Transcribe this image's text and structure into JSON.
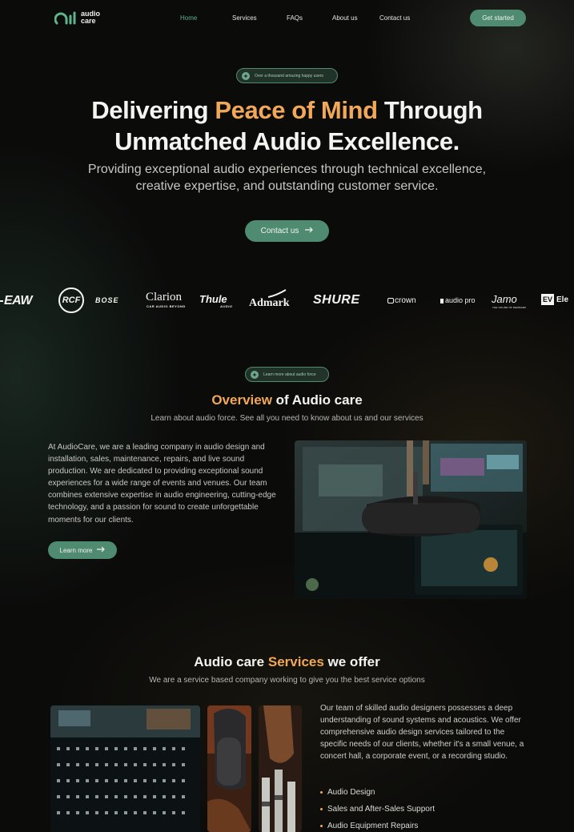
{
  "nav": {
    "logo_line1": "audio",
    "logo_line2": "care",
    "links": [
      "Home",
      "Services",
      "FAQs",
      "About us",
      "Contact us"
    ],
    "cta": "Get started"
  },
  "hero": {
    "pill": "Over a thousand amazing happy users",
    "title_pre": "Delivering ",
    "title_accent": "Peace of Mind",
    "title_post": " Through",
    "title_line2": "Unmatched Audio Excellence.",
    "subtitle_line1": "Providing exceptional audio experiences through technical excellence,",
    "subtitle_line2": "creative expertise, and outstanding customer service.",
    "cta": "Contact us"
  },
  "brands": {
    "eaw": "EAW",
    "rcf": "RCF",
    "bose": "BOSE",
    "clarion": "Clarion",
    "clarion_tag": "CAR AUDIO BEYOND",
    "thule": "Thule",
    "thule_tag": "AUDIO",
    "admark": "Admark",
    "shure": "SHURE",
    "crown": "crown",
    "audiopro": "audio pro",
    "jamo": "Jamo",
    "jamo_tag": "THE SOUND OF DENMARK",
    "ev": "EV",
    "ev_text": "Ele"
  },
  "overview": {
    "pill": "Learn more about audio force",
    "title_accent": "Overview",
    "title_post": " of Audio care",
    "subtitle": "Learn about audio force. See all you need to know about us and our services",
    "body": "At AudioCare, we are a leading company in audio design and installation, sales, maintenance, repairs, and live sound production. We are dedicated to providing exceptional sound experiences for a wide range of events and venues. Our team combines extensive expertise in audio engineering, cutting-edge technology, and a passion for sound to create unforgettable moments for our clients.",
    "cta": "Learn more"
  },
  "services": {
    "title_pre": "Audio care ",
    "title_accent": "Services",
    "title_post": " we offer",
    "subtitle": "We are a service based company working to give you the best service options",
    "body": "Our team of skilled audio designers possesses a deep understanding of sound systems and acoustics. We offer comprehensive audio design services tailored to the specific needs of our clients, whether it's a small venue, a concert hall, a corporate event, or a recording studio.",
    "items": [
      "Audio Design",
      "Sales and After-Sales Support",
      "Audio Equipment Repairs"
    ]
  },
  "colors": {
    "accent_green": "#4f8b70",
    "accent_orange": "#f2a859",
    "background": "#0b0b0a"
  },
  "icons": [
    "logo-icon",
    "sparkle-icon",
    "arrow-right-icon",
    "bullet-icon"
  ]
}
